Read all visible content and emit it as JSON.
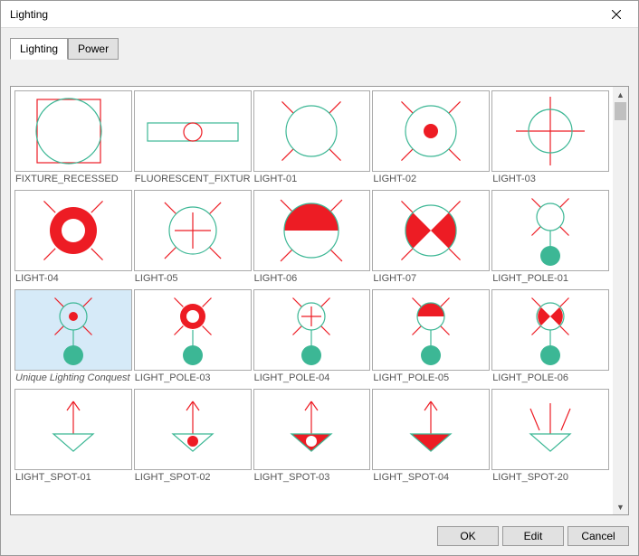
{
  "window": {
    "title": "Lighting"
  },
  "tabs": [
    {
      "label": "Lighting",
      "active": true
    },
    {
      "label": "Power",
      "active": false
    }
  ],
  "selected_index": 10,
  "items": [
    {
      "label": "FIXTURE_RECESSED",
      "icon": "fixture_recessed"
    },
    {
      "label": "FLUORESCENT_FIXTUR",
      "icon": "fluorescent"
    },
    {
      "label": "LIGHT-01",
      "icon": "circle_x"
    },
    {
      "label": "LIGHT-02",
      "icon": "circle_x_dot"
    },
    {
      "label": "LIGHT-03",
      "icon": "circle_cross"
    },
    {
      "label": "LIGHT-04",
      "icon": "ring_x"
    },
    {
      "label": "LIGHT-05",
      "icon": "circle_x_cross"
    },
    {
      "label": "LIGHT-06",
      "icon": "half_top"
    },
    {
      "label": "LIGHT-07",
      "icon": "bowtie"
    },
    {
      "label": "LIGHT_POLE-01",
      "icon": "pole_plain"
    },
    {
      "label": "Unique Lighting Conquest",
      "icon": "pole_dot",
      "selected": true
    },
    {
      "label": "LIGHT_POLE-03",
      "icon": "pole_ring"
    },
    {
      "label": "LIGHT_POLE-04",
      "icon": "pole_cross"
    },
    {
      "label": "LIGHT_POLE-05",
      "icon": "pole_half"
    },
    {
      "label": "LIGHT_POLE-06",
      "icon": "pole_bowtie"
    },
    {
      "label": "LIGHT_SPOT-01",
      "icon": "spot_tri"
    },
    {
      "label": "LIGHT_SPOT-02",
      "icon": "spot_tri_dot"
    },
    {
      "label": "LIGHT_SPOT-03",
      "icon": "spot_tri_fill_hole"
    },
    {
      "label": "LIGHT_SPOT-04",
      "icon": "spot_tri_fill"
    },
    {
      "label": "LIGHT_SPOT-20",
      "icon": "spot_tri_rays"
    }
  ],
  "buttons": {
    "ok": "OK",
    "edit": "Edit",
    "cancel": "Cancel"
  },
  "colors": {
    "red": "#ed1c24",
    "teal": "#3cb795"
  }
}
